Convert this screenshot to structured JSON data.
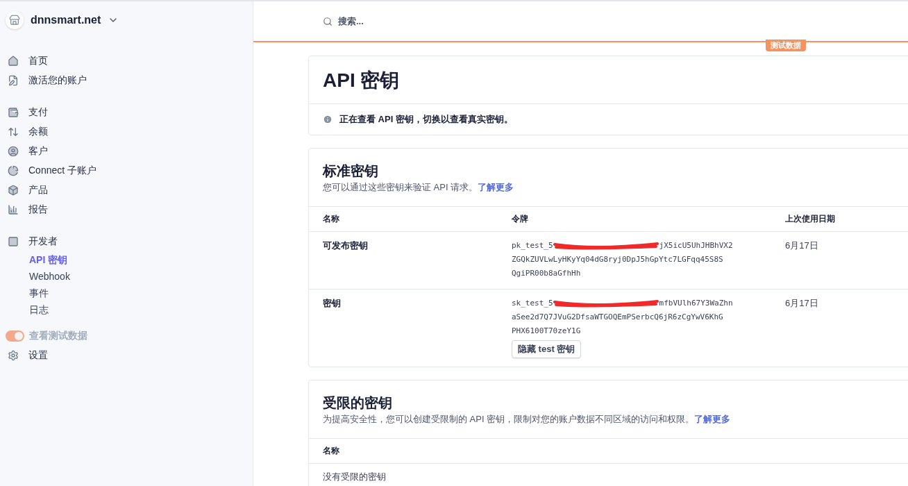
{
  "account": {
    "name": "dnnsmart.net"
  },
  "nav_groups": [
    {
      "items": [
        {
          "label": "首页"
        },
        {
          "label": "激活您的账户"
        }
      ]
    },
    {
      "items": [
        {
          "label": "支付"
        },
        {
          "label": "余额"
        },
        {
          "label": "客户"
        },
        {
          "label": "Connect 子账户"
        },
        {
          "label": "产品"
        },
        {
          "label": "报告"
        }
      ]
    },
    {
      "items": [
        {
          "label": "开发者",
          "children": [
            {
              "label": "API 密钥",
              "selected": true
            },
            {
              "label": "Webhook",
              "selected": false
            },
            {
              "label": "事件",
              "selected": false
            },
            {
              "label": "日志",
              "selected": false
            }
          ]
        }
      ]
    }
  ],
  "test_toggle": {
    "label": "查看测试数据",
    "on": true
  },
  "settings": {
    "label": "设置"
  },
  "search": {
    "placeholder": "搜索..."
  },
  "test_badge": "测试数据",
  "page_title": "API 密钥",
  "notice": "正在查看 API 密钥，切换以查看真实密钥。",
  "standard_keys": {
    "title": "标准密钥",
    "description": "您可以通过这些密钥来验证 API 请求。",
    "link": "了解更多",
    "columns": [
      "名称",
      "令牌",
      "上次使用日期"
    ],
    "rows": [
      {
        "name": "可发布密钥",
        "token_start": "pk_test_5",
        "token_end": "jX5icU5UhJHBhVX2",
        "token_lines": [
          "ZGQkZUVLwLyHKyYq04dG8ryj0DpJ5hGpYtc7LGFqq45S8S",
          "QgiPR00b8aGfhHh"
        ],
        "last_used": "6月17日"
      },
      {
        "name": "密钥",
        "token_start": "sk_test_5",
        "token_end": "mfbVUlh67Y3WaZhn",
        "token_lines": [
          "aSee2d7Q7JVuG2DfsaWTGOQEmPSerbcQ6jR6zCgYwV6KhG",
          "PHX6100T70zeY1G"
        ],
        "last_used": "6月17日",
        "button": "隐藏 test 密钥"
      }
    ]
  },
  "restricted_keys": {
    "title": "受限的密钥",
    "description": "为提高安全性，您可以创建受限制的 API 密钥，限制对您的账户数据不同区域的访问和权限。",
    "link": "了解更多",
    "columns": [
      "名称"
    ],
    "empty": "没有受限的密钥"
  }
}
